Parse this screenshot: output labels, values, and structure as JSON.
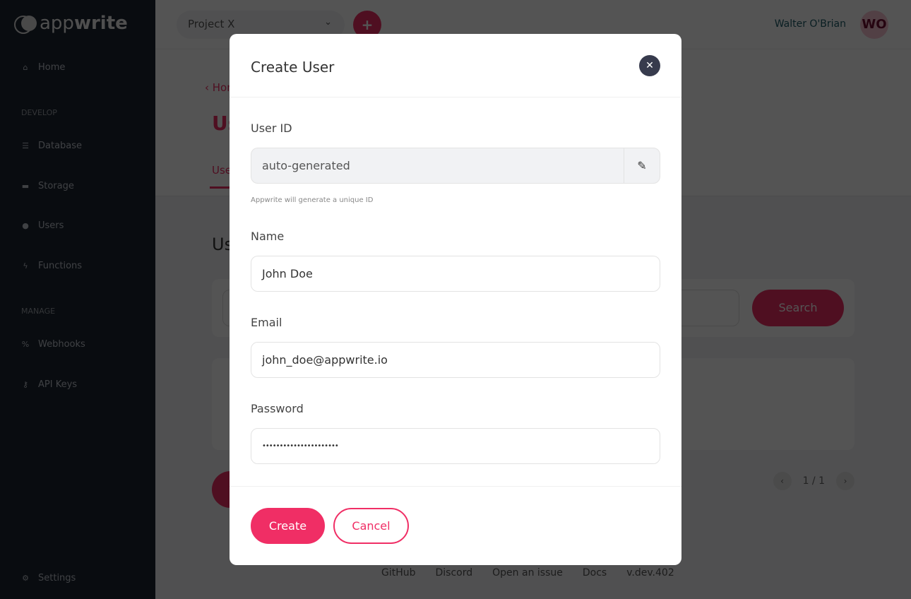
{
  "brand": {
    "logo_light": "app",
    "logo_bold": "write"
  },
  "sidebar": {
    "home": "Home",
    "sections": [
      "DEVELOP",
      "MANAGE"
    ],
    "develop": [
      {
        "label": "Database",
        "icon": "database-icon"
      },
      {
        "label": "Storage",
        "icon": "folder-icon"
      },
      {
        "label": "Users",
        "icon": "users-icon"
      },
      {
        "label": "Functions",
        "icon": "bolt-icon"
      }
    ],
    "manage": [
      {
        "label": "Webhooks",
        "icon": "webhook-icon"
      },
      {
        "label": "API Keys",
        "icon": "key-icon"
      }
    ],
    "settings": "Settings"
  },
  "header": {
    "project": "Project X",
    "add": "+",
    "user_name": "Walter O'Brian",
    "avatar_initials": "WO"
  },
  "page": {
    "breadcrumb": "Home",
    "title": "Users",
    "tab": "Users",
    "section_title": "Users",
    "search_button": "Search",
    "pagination": "1 / 1"
  },
  "footer": {
    "links": [
      "GitHub",
      "Discord",
      "Open an issue",
      "Docs",
      "v.dev.402"
    ]
  },
  "modal": {
    "title": "Create User",
    "user_id_label": "User ID",
    "user_id_value": "auto-generated",
    "user_id_hint": "Appwrite will generate a unique ID",
    "name_label": "Name",
    "name_value": "John Doe",
    "email_label": "Email",
    "email_value": "john_doe@appwrite.io",
    "password_label": "Password",
    "password_value": "••••••••••••••••••••••",
    "create": "Create",
    "cancel": "Cancel"
  },
  "colors": {
    "accent": "#f02e65",
    "sidebar": "#1b2330",
    "close_button": "#373b4d"
  }
}
